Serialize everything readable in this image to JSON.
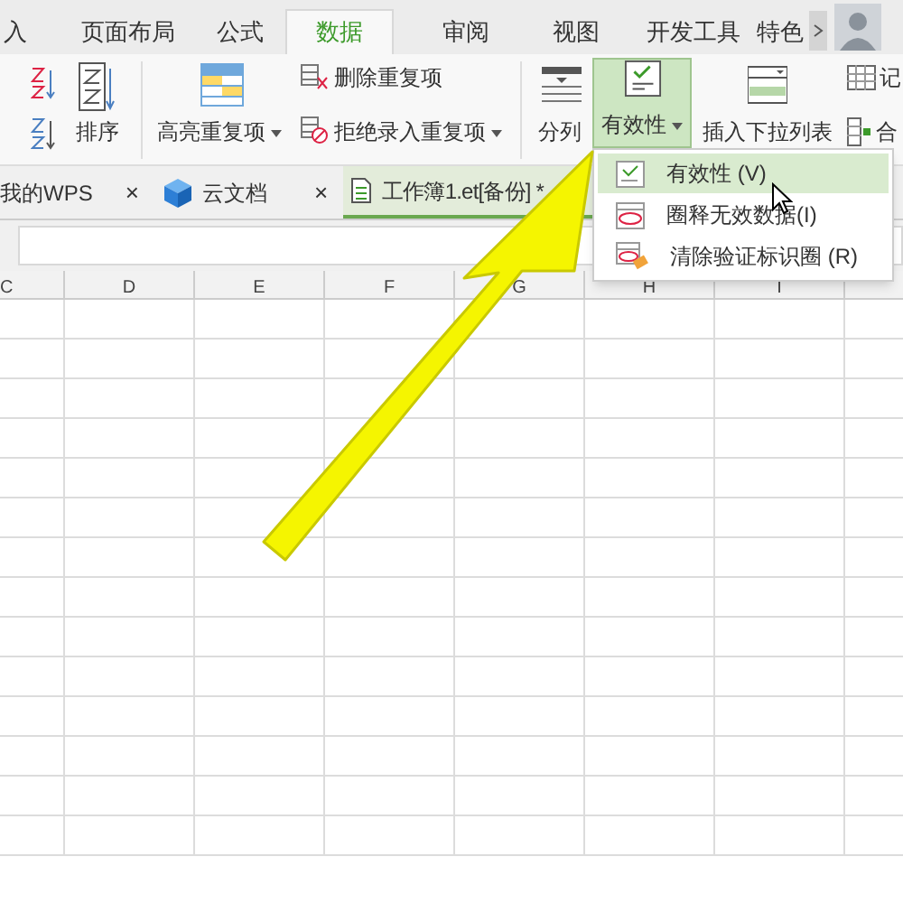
{
  "menu_tabs": [
    {
      "label": "入",
      "selected": false
    },
    {
      "label": "页面布局",
      "selected": false
    },
    {
      "label": "公式",
      "selected": false
    },
    {
      "label": "数据",
      "selected": true
    },
    {
      "label": "审阅",
      "selected": false
    },
    {
      "label": "视图",
      "selected": false
    },
    {
      "label": "开发工具",
      "selected": false
    },
    {
      "label": "特色",
      "selected": false
    }
  ],
  "ribbon": {
    "sort": "排序",
    "highlight_duplicates": "高亮重复项",
    "delete_duplicates": "删除重复项",
    "reject_duplicates": "拒绝录入重复项",
    "split": "分列",
    "validity": {
      "label": "有效性",
      "expanded": true
    },
    "insert_dropdown": "插入下拉列表",
    "record": "记",
    "merge": "合"
  },
  "doc_tabs": [
    {
      "kind": "home",
      "label": "我的WPS",
      "close": "×",
      "selected": false
    },
    {
      "kind": "cloud",
      "label": "云文档",
      "close": "×",
      "selected": false
    },
    {
      "kind": "file",
      "label": "工作簿1.et[备份] *",
      "selected": true
    }
  ],
  "columns": [
    "C",
    "D",
    "E",
    "F",
    "G",
    "H",
    "I"
  ],
  "dropdown": [
    {
      "kind": "validity",
      "label": "有效性 (V)",
      "selected": true
    },
    {
      "kind": "circle",
      "label": "圈释无效数据(I)",
      "selected": false
    },
    {
      "kind": "clear",
      "label": "清除验证标识圈 (R)",
      "selected": false
    }
  ]
}
